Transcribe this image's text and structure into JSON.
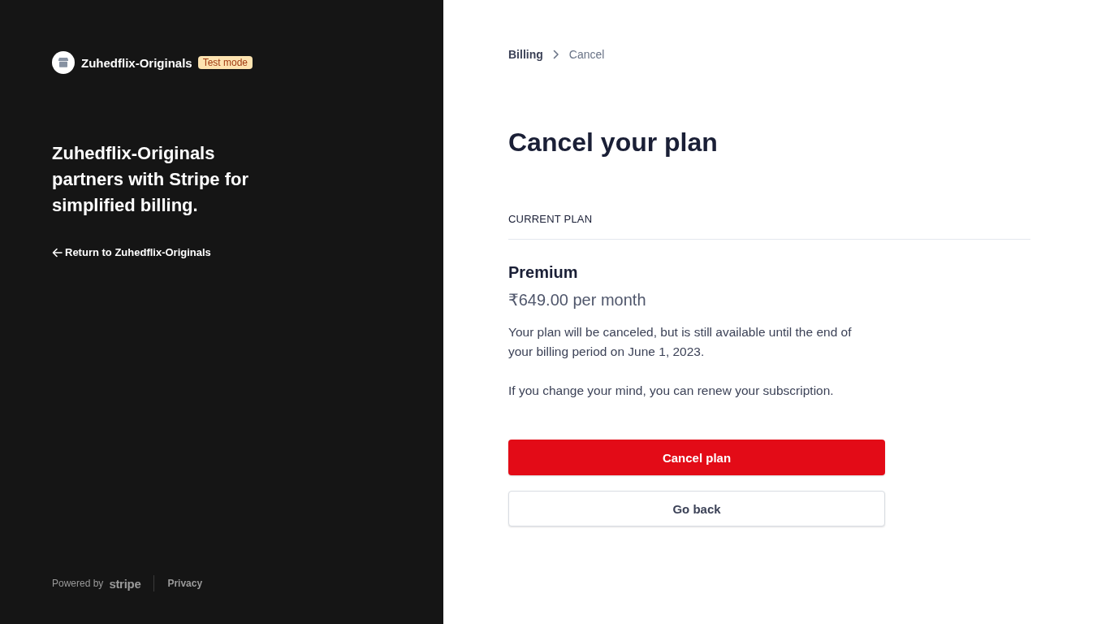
{
  "brand": {
    "name": "Zuhedflix-Originals",
    "badge": "Test mode"
  },
  "tagline": "Zuhedflix-Originals partners with Stripe for simplified billing.",
  "return_link": "Return to Zuhedflix-Originals",
  "footer": {
    "powered_by": "Powered by",
    "logo_text": "stripe",
    "links": [
      "Privacy"
    ]
  },
  "breadcrumb": [
    {
      "label": "Billing",
      "current": false
    },
    {
      "label": "Cancel",
      "current": true
    }
  ],
  "title": "Cancel your plan",
  "section_label": "CURRENT PLAN",
  "plan": {
    "name": "Premium",
    "price": "₹649.00 per month"
  },
  "messages": [
    "Your plan will be canceled, but is still available until the end of your billing period on June 1, 2023.",
    "If you change your mind, you can renew your subscription."
  ],
  "buttons": [
    {
      "label": "Cancel plan",
      "kind": "primary"
    },
    {
      "label": "Go back",
      "kind": "secondary"
    }
  ]
}
